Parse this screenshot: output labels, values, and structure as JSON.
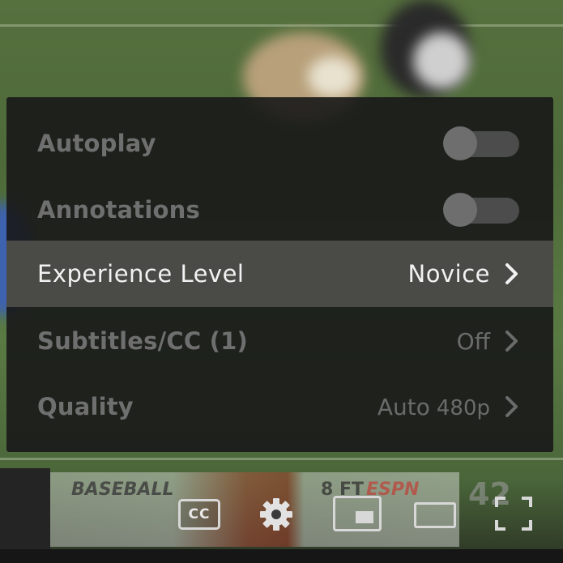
{
  "settings_menu": {
    "autoplay": {
      "label": "Autoplay",
      "enabled": false
    },
    "annotations": {
      "label": "Annotations",
      "enabled": false
    },
    "experience_level": {
      "label": "Experience Level",
      "value": "Novice"
    },
    "subtitles": {
      "label": "Subtitles/CC (1)",
      "value": "Off"
    },
    "quality": {
      "label": "Quality",
      "value": "Auto",
      "value_detail": "480p"
    }
  },
  "scoreboard": {
    "league_text": "BASEBALL",
    "count_text": "8 FT",
    "network_text": "ESPN",
    "score_text": "42"
  },
  "controls": {
    "cc_label": "CC",
    "icons": [
      "cc-icon",
      "gear-icon",
      "miniplayer-icon",
      "theater-mode-icon",
      "fullscreen-icon"
    ]
  },
  "colors": {
    "panel_bg": "#181818",
    "highlight_bg": "#52524e",
    "active_text": "#f2f2f2",
    "dim_text": "#6f6f6f"
  }
}
